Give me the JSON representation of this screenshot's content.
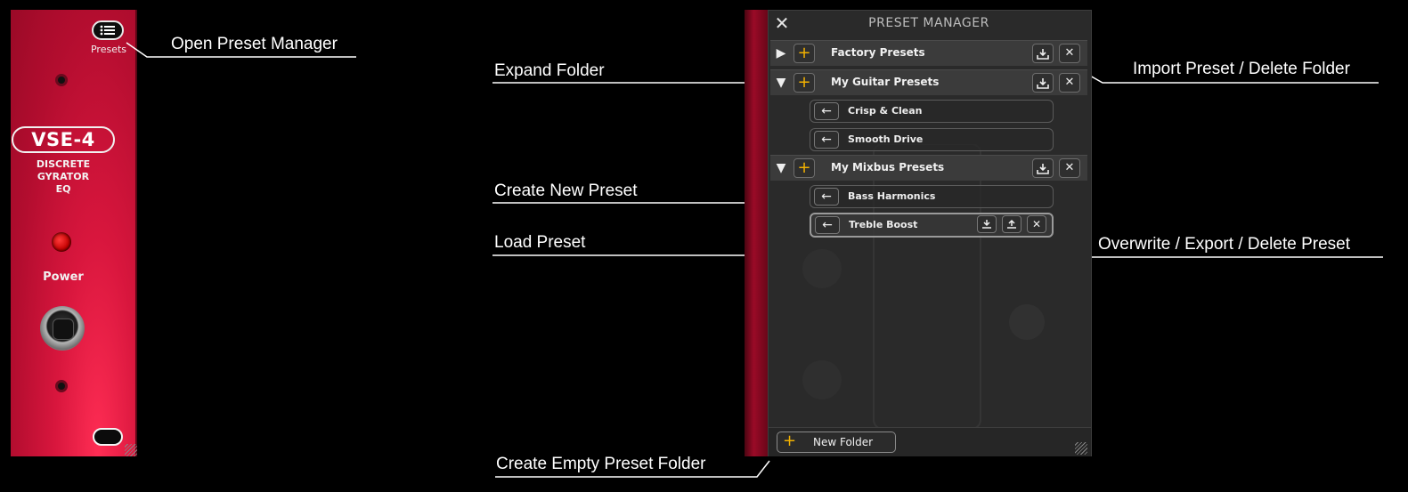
{
  "module": {
    "presets_label": "Presets",
    "model": "VSE-4",
    "description_lines": [
      "DISCRETE",
      "GYRATOR",
      "EQ"
    ],
    "power_label": "Power"
  },
  "callouts": {
    "open_preset_manager": "Open Preset Manager",
    "expand_folder": "Expand Folder",
    "create_new_preset": "Create New Preset",
    "load_preset": "Load Preset",
    "create_empty_folder": "Create Empty Preset Folder",
    "import_delete_folder": "Import  Preset / Delete Folder",
    "overwrite_export_delete": "Overwrite / Export / Delete Preset"
  },
  "panel": {
    "close_glyph": "✕",
    "title": "PRESET MANAGER",
    "folders": [
      {
        "name": "Factory Presets",
        "toggle": "▶",
        "presets": []
      },
      {
        "name": "My Guitar Presets",
        "toggle": "▼",
        "presets": [
          "Crisp & Clean",
          "Smooth Drive"
        ]
      },
      {
        "name": "My Mixbus Presets",
        "toggle": "▼",
        "presets": [
          "Bass Harmonics",
          "Treble Boost"
        ]
      }
    ],
    "add_glyph": "+",
    "delete_glyph": "✕",
    "load_glyph": "←",
    "new_folder_label": "New Folder"
  },
  "colors": {
    "accent": "#f2b100",
    "module_red": "#d8163d",
    "panel_bg": "#2a2a2a"
  }
}
